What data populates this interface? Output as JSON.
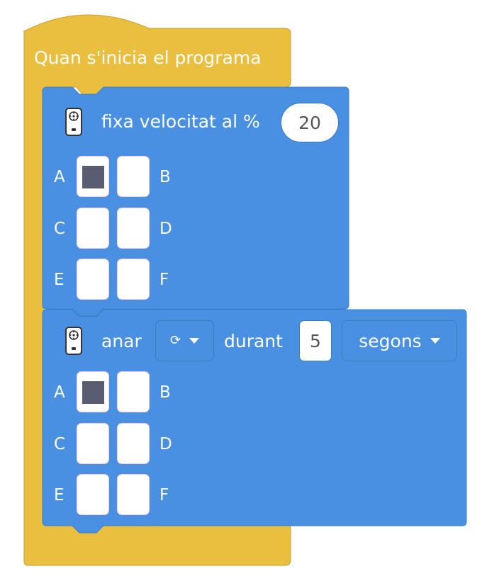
{
  "colors": {
    "event": "#eabf3f",
    "motion": "#4a90e2",
    "selected_port": "#5a5d72"
  },
  "hat": {
    "title": "Quan s'inicia el programa"
  },
  "block1": {
    "icon": "motor-icon",
    "label": "fixa velocitat al %",
    "value": "20",
    "ports": [
      {
        "label": "A",
        "selected": true
      },
      {
        "label": "B",
        "selected": false
      },
      {
        "label": "C",
        "selected": false
      },
      {
        "label": "D",
        "selected": false
      },
      {
        "label": "E",
        "selected": false
      },
      {
        "label": "F",
        "selected": false
      }
    ]
  },
  "block2": {
    "icon": "motor-icon",
    "label_go": "anar",
    "direction_icon": "clockwise-icon",
    "label_during": "durant",
    "value": "5",
    "unit": "segons",
    "ports": [
      {
        "label": "A",
        "selected": true
      },
      {
        "label": "B",
        "selected": false
      },
      {
        "label": "C",
        "selected": false
      },
      {
        "label": "D",
        "selected": false
      },
      {
        "label": "E",
        "selected": false
      },
      {
        "label": "F",
        "selected": false
      }
    ]
  }
}
